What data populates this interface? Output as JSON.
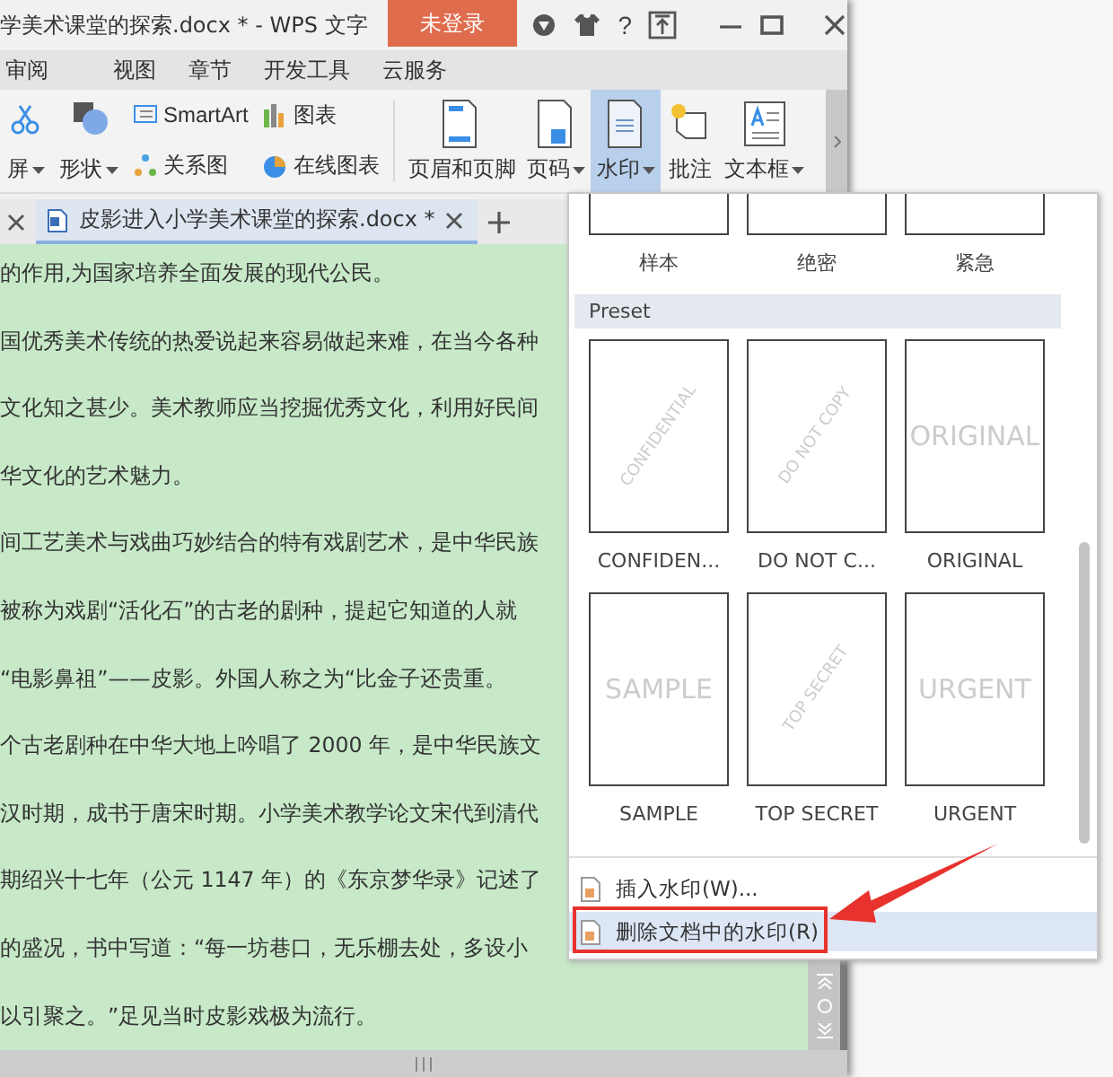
{
  "window": {
    "title": "学美术课堂的探索.docx * - WPS 文字",
    "login_button": "未登录",
    "help": "?"
  },
  "menu_tabs": [
    {
      "label": "审阅",
      "selected": false
    },
    {
      "label": "视图",
      "selected": false
    },
    {
      "label": "章节",
      "selected": false
    },
    {
      "label": "开发工具",
      "selected": false
    },
    {
      "label": "云服务",
      "selected": false
    }
  ],
  "ribbon": {
    "small_columns": [
      {
        "label": "屏",
        "dropdown": true
      },
      {
        "label": "形状",
        "dropdown": true
      }
    ],
    "small_rows": [
      {
        "label": "SmartArt"
      },
      {
        "label": "关系图"
      },
      {
        "label": "图表"
      },
      {
        "label": "在线图表"
      }
    ],
    "large_buttons": [
      {
        "label": "页眉和页脚",
        "dropdown": false,
        "selected": false
      },
      {
        "label": "页码",
        "dropdown": true,
        "selected": false
      },
      {
        "label": "水印",
        "dropdown": true,
        "selected": true
      },
      {
        "label": "批注",
        "dropdown": false,
        "selected": false
      },
      {
        "label": "文本框",
        "dropdown": true,
        "selected": false
      }
    ]
  },
  "document_tabs": [
    {
      "title": "皮影进入小学美术课堂的探索.docx *",
      "selected": true
    }
  ],
  "document_lines": [
    "的作用,为国家培养全面发展的现代公民。",
    "国优秀美术传统的热爱说起来容易做起来难，在当今各种",
    "文化知之甚少。美术教师应当挖掘优秀文化，利用好民间",
    "华文化的艺术魅力。",
    "间工艺美术与戏曲巧妙结合的特有戏剧艺术，是中华民族",
    "被称为戏剧“活化石”的古老的剧种，提起它知道的人就",
    "“电影鼻祖”——皮影。外国人称之为“比金子还贵重。",
    "个古老剧种在中华大地上吟唱了 2000 年，是中华民族文",
    "汉时期，成书于唐宋时期。小学美术教学论文宋代到清代",
    "期绍兴十七年（公元 1147 年）的《东京梦华录》记述了",
    "的盛况，书中写道：“每一坊巷口，无乐棚去处，多设小",
    "以引聚之。”足见当时皮影戏极为流行。"
  ],
  "watermark_menu": {
    "custom": [
      {
        "label": "样本"
      },
      {
        "label": "绝密"
      },
      {
        "label": "紧急"
      }
    ],
    "preset_header": "Preset",
    "presets": [
      {
        "label": "CONFIDEN...",
        "thumb_text": "CONFIDENTIAL",
        "kind": "diagonal"
      },
      {
        "label": "DO NOT C...",
        "thumb_text": "DO NOT COPY",
        "kind": "diagonal"
      },
      {
        "label": "ORIGINAL",
        "thumb_text": "ORIGINAL",
        "kind": "horizontal"
      },
      {
        "label": "SAMPLE",
        "thumb_text": "SAMPLE",
        "kind": "horizontal"
      },
      {
        "label": "TOP SECRET",
        "thumb_text": "TOP SECRET",
        "kind": "diagonal"
      },
      {
        "label": "URGENT",
        "thumb_text": "URGENT",
        "kind": "horizontal"
      }
    ],
    "items": [
      {
        "label": "插入水印(W)...",
        "selected": false
      },
      {
        "label": "删除文档中的水印(R)",
        "selected": true
      }
    ]
  }
}
